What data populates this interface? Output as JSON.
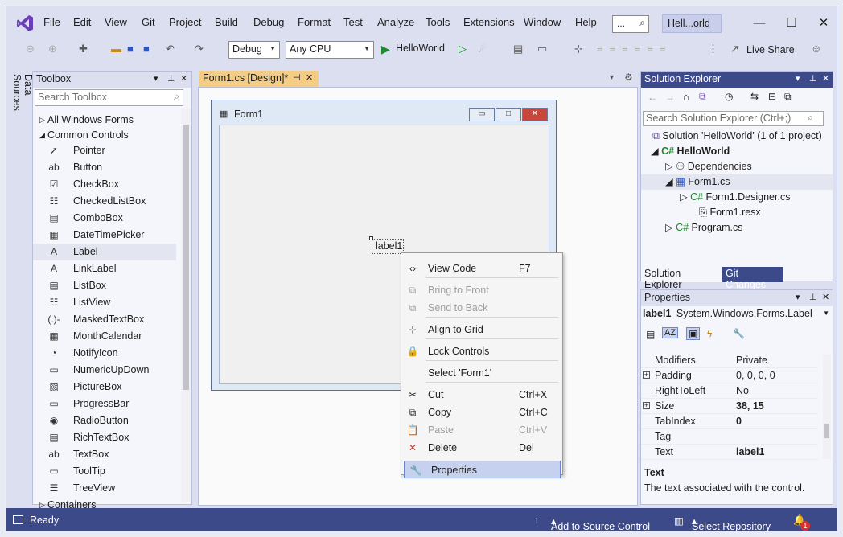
{
  "menu": [
    "File",
    "Edit",
    "View",
    "Git",
    "Project",
    "Build",
    "Debug",
    "Format",
    "Test",
    "Analyze",
    "Tools",
    "Extensions",
    "Window",
    "Help"
  ],
  "search_label": "...",
  "title_badge": "Hell...orld",
  "toolbar": {
    "config": "Debug",
    "platform": "Any CPU",
    "run_target": "HelloWorld",
    "live_share": "Live Share"
  },
  "side_tab": "Data Sources",
  "toolbox": {
    "title": "Toolbox",
    "search_placeholder": "Search Toolbox",
    "groups": [
      "All Windows Forms",
      "Common Controls",
      "Containers"
    ],
    "items": [
      "Pointer",
      "Button",
      "CheckBox",
      "CheckedListBox",
      "ComboBox",
      "DateTimePicker",
      "Label",
      "LinkLabel",
      "ListBox",
      "ListView",
      "MaskedTextBox",
      "MonthCalendar",
      "NotifyIcon",
      "NumericUpDown",
      "PictureBox",
      "ProgressBar",
      "RadioButton",
      "RichTextBox",
      "TextBox",
      "ToolTip",
      "TreeView"
    ]
  },
  "doc_tab": "Form1.cs [Design]*",
  "form": {
    "title": "Form1",
    "label": "label1"
  },
  "context_menu": [
    {
      "label": "View Code",
      "shortcut": "F7",
      "icon": "code-icon",
      "enabled": true
    },
    {
      "label": "Bring to Front",
      "shortcut": "",
      "icon": "bring-front-icon",
      "enabled": false
    },
    {
      "label": "Send to Back",
      "shortcut": "",
      "icon": "send-back-icon",
      "enabled": false
    },
    {
      "label": "Align to Grid",
      "shortcut": "",
      "icon": "align-grid-icon",
      "enabled": true
    },
    {
      "label": "Lock Controls",
      "shortcut": "",
      "icon": "lock-icon",
      "enabled": true
    },
    {
      "label": "Select 'Form1'",
      "shortcut": "",
      "icon": "",
      "enabled": true
    },
    {
      "label": "Cut",
      "shortcut": "Ctrl+X",
      "icon": "cut-icon",
      "enabled": true
    },
    {
      "label": "Copy",
      "shortcut": "Ctrl+C",
      "icon": "copy-icon",
      "enabled": true
    },
    {
      "label": "Paste",
      "shortcut": "Ctrl+V",
      "icon": "paste-icon",
      "enabled": false
    },
    {
      "label": "Delete",
      "shortcut": "Del",
      "icon": "delete-icon",
      "enabled": true
    },
    {
      "label": "Properties",
      "shortcut": "",
      "icon": "wrench-icon",
      "enabled": true
    }
  ],
  "solution_explorer": {
    "title": "Solution Explorer",
    "search_placeholder": "Search Solution Explorer (Ctrl+;)",
    "solution": "Solution 'HelloWorld' (1 of 1 project)",
    "project": "HelloWorld",
    "dependencies": "Dependencies",
    "form_cs": "Form1.cs",
    "designer_cs": "Form1.Designer.cs",
    "resx": "Form1.resx",
    "program_cs": "Program.cs",
    "tabs": [
      "Solution Explorer",
      "Git Changes"
    ]
  },
  "properties": {
    "title": "Properties",
    "object": "label1",
    "object_type": "System.Windows.Forms.Label",
    "rows": [
      {
        "name": "Modifiers",
        "value": "Private",
        "expandable": false,
        "bold": false
      },
      {
        "name": "Padding",
        "value": "0, 0, 0, 0",
        "expandable": true,
        "bold": false
      },
      {
        "name": "RightToLeft",
        "value": "No",
        "expandable": false,
        "bold": false
      },
      {
        "name": "Size",
        "value": "38, 15",
        "expandable": true,
        "bold": true
      },
      {
        "name": "TabIndex",
        "value": "0",
        "expandable": false,
        "bold": true
      },
      {
        "name": "Tag",
        "value": "",
        "expandable": false,
        "bold": false
      },
      {
        "name": "Text",
        "value": "label1",
        "expandable": false,
        "bold": true
      }
    ],
    "desc_title": "Text",
    "desc_text": "The text associated with the control."
  },
  "status": {
    "ready": "Ready",
    "source_control": "Add to Source Control",
    "repository": "Select Repository",
    "notifications": "1"
  },
  "colors": {
    "accent": "#3d4a8a",
    "tab_active": "#f5cc84",
    "highlight": "#c6d1ef"
  }
}
